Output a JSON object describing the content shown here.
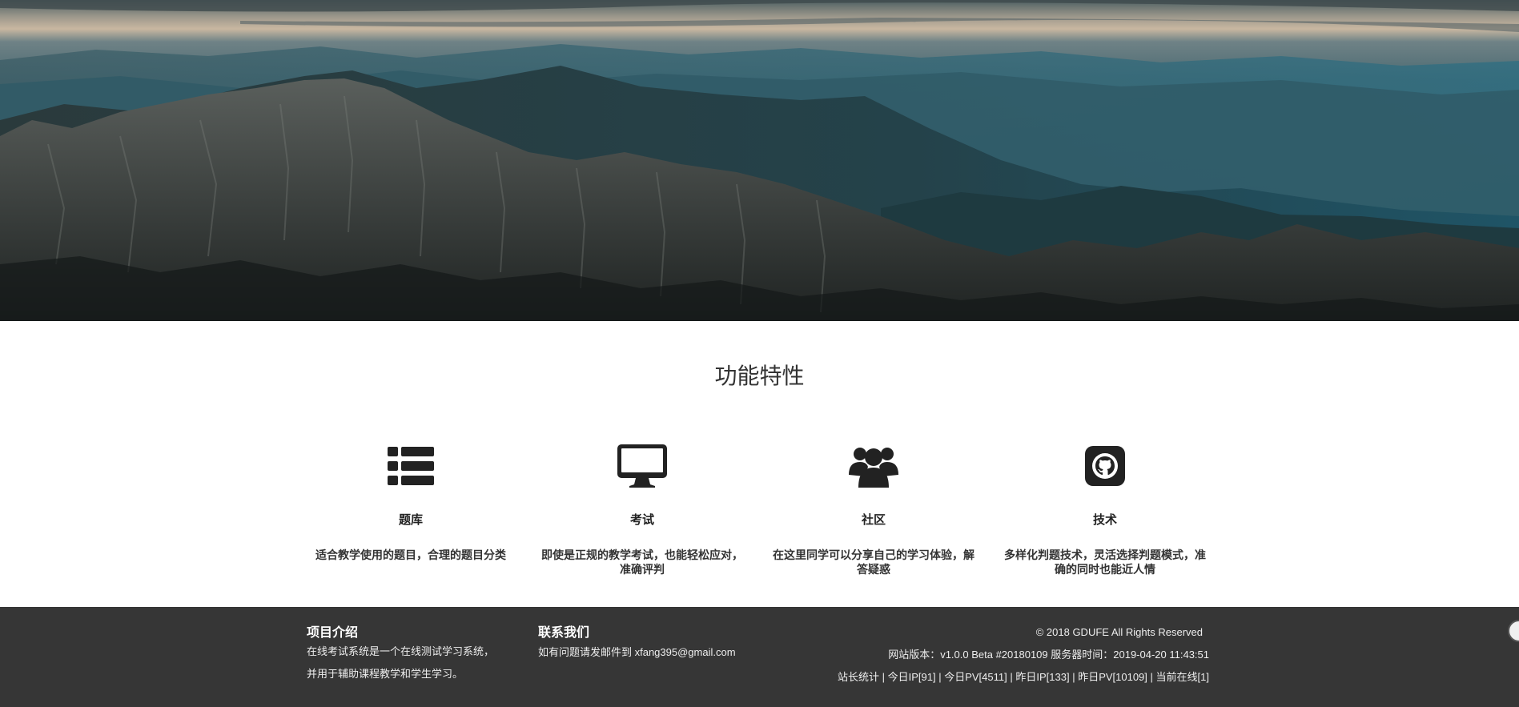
{
  "hero": {
    "image": "mountain-landscape-banner"
  },
  "features": {
    "title": "功能特性",
    "items": [
      {
        "icon": "list-icon",
        "name": "题库",
        "desc": "适合教学使用的题目，合理的题目分类"
      },
      {
        "icon": "monitor-icon",
        "name": "考试",
        "desc": "即使是正规的教学考试，也能轻松应对，准确评判"
      },
      {
        "icon": "users-icon",
        "name": "社区",
        "desc": "在这里同学可以分享自己的学习体验，解答疑惑"
      },
      {
        "icon": "github-icon",
        "name": "技术",
        "desc": "多样化判题技术，灵活选择判题模式，准确的同时也能近人情"
      }
    ]
  },
  "footer": {
    "about": {
      "title": "项目介绍",
      "line1": "在线考试系统是一个在线测试学习系统，",
      "line2": "并用于辅助课程教学和学生学习。"
    },
    "contact": {
      "title": "联系我们",
      "text": "如有问题请发邮件到 xfang395@gmail.com"
    },
    "copyright": "© 2018 GDUFE All Rights Reserved",
    "version_line": "网站版本：v1.0.0 Beta #20180109  服务器时间：2019-04-20 11:43:51",
    "stats": {
      "label": "站长统计",
      "today_ip": "今日IP[91]",
      "today_pv": "今日PV[4511]",
      "yesterday_ip": "昨日IP[133]",
      "yesterday_pv": "昨日PV[10109]",
      "online": "当前在线[1]"
    }
  },
  "colors": {
    "footer_bg": "#363636",
    "text_dark": "#222222"
  }
}
